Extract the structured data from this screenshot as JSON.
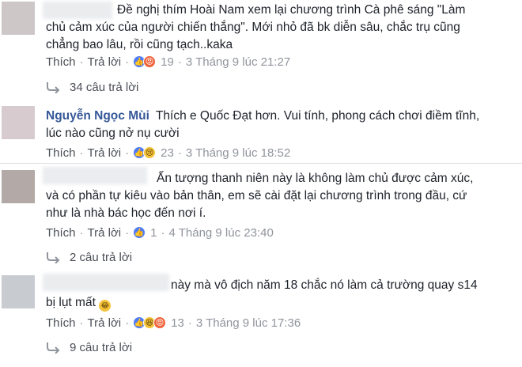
{
  "comments": [
    {
      "author": "",
      "text_lines": [
        "Đề nghị thím Hoài Nam xem lại chương trình Cà phê sáng \"Làm",
        "chủ cảm xúc của người chiến thắng\". Mới nhỏ đã bk diễn sâu, chắc trụ cũng",
        "chẳng bao lâu, rồi cũng tạch..kaka"
      ],
      "like_label": "Thích",
      "reply_label": "Trả lời",
      "reaction_icons": [
        "like-icon",
        "angry-icon"
      ],
      "reaction_count": "19",
      "timestamp": "3 Tháng 9 lúc 21:27",
      "replies_label": "34 câu trả lời"
    },
    {
      "author": "Nguyễn Ngọc Mùi",
      "text_lines": [
        "Thích e Quốc Đạt hơn. Vui tính, phong cách chơi điềm tĩnh,",
        "lúc nào cũng nở nụ cười"
      ],
      "like_label": "Thích",
      "reply_label": "Trả lời",
      "reaction_icons": [
        "like-icon",
        "sad-icon"
      ],
      "reaction_count": "23",
      "timestamp": "3 Tháng 9 lúc 18:52",
      "replies_label": ""
    },
    {
      "author": "",
      "text_lines": [
        "Ấn tượng thanh niên này là không làm chủ được cảm xúc,",
        "và có phần tự kiêu vào bản thân, em sẽ cài đặt lại chương trình trong đầu, cứ",
        "như là nhà bác học đến nơi í."
      ],
      "like_label": "Thích",
      "reply_label": "Trả lời",
      "reaction_icons": [
        "like-icon"
      ],
      "reaction_count": "1",
      "timestamp": "4 Tháng 9 lúc 23:40",
      "replies_label": "2 câu trả lời"
    },
    {
      "author": "",
      "text_lines": [
        "này mà vô địch năm 18 chắc nó làm cả trường quay s14",
        "bị lụt mất"
      ],
      "like_label": "Thích",
      "reply_label": "Trả lời",
      "reaction_icons": [
        "like-icon",
        "haha-icon",
        "angry-icon"
      ],
      "reaction_count": "13",
      "timestamp": "3 Tháng 9 lúc 17:36",
      "replies_label": "9 câu trả lời"
    }
  ],
  "colors": {
    "author": "#365899",
    "meta": "#90949c",
    "link": "#4b4f56",
    "like": "#4f7df8",
    "angry": "#f0643c",
    "haha": "#f5c33b"
  }
}
